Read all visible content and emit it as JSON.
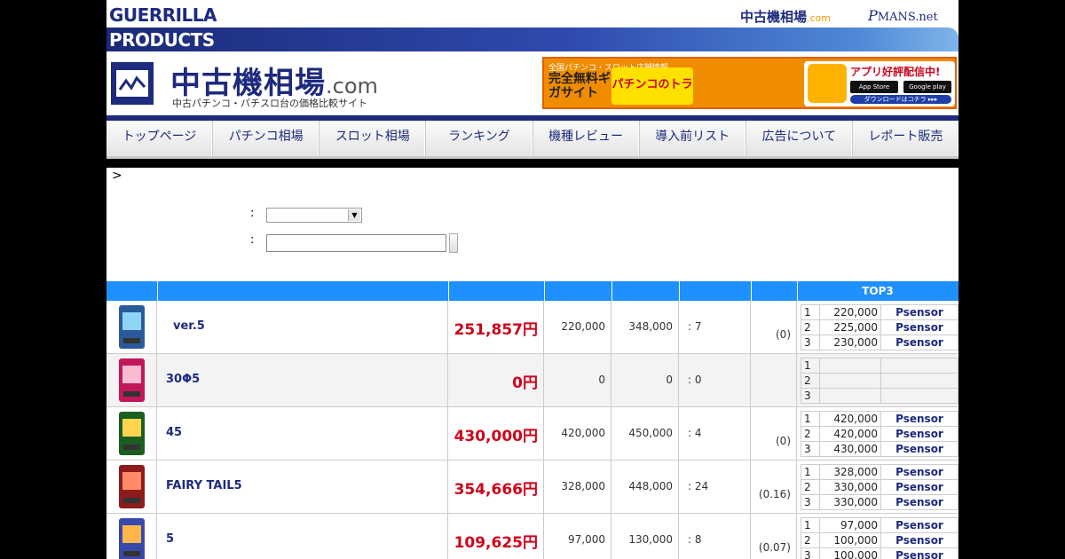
{
  "header": {
    "logo_line1": "GUERRILLA",
    "logo_line2": "PRODUCTS",
    "toplink_chuko": "中古機相場",
    "toplink_chuko_domain": ".com",
    "toplink_pmans_p": "P",
    "toplink_pmans_rest": "MANS.net",
    "site_title": "中古機相場",
    "site_title_domain": ".com",
    "site_subtitle": "中古パチンコ・パチスロ台の価格比較サイト"
  },
  "ad": {
    "line1": "全国パチンコ・スロット店舗情報",
    "line2": "完全無料ギガサイト",
    "brand": "パチンコのトラ",
    "app": "アプリ好評配信中!",
    "store1": "App Store",
    "store2": "Google play",
    "download": "ダウンロードはコチラ ▸▸▸"
  },
  "nav": [
    "トップページ",
    "パチンコ相場",
    "スロット相場",
    "ランキング",
    "機種レビュー",
    "導入前リスト",
    "広告について",
    "レポート販売"
  ],
  "breadcrumb": ">",
  "filters": {
    "label1": ":",
    "label2": ":"
  },
  "table": {
    "top3_header": "TOP3",
    "rows": [
      {
        "name": "ver.5",
        "price": "251,857円",
        "min": "220,000",
        "max": "348,000",
        "count": ": 7",
        "rate": "(0)",
        "top": [
          [
            "1",
            "220,000",
            "Psensor"
          ],
          [
            "2",
            "225,000",
            "Psensor"
          ],
          [
            "3",
            "230,000",
            "Psensor"
          ]
        ]
      },
      {
        "name": "30Φ5",
        "price": "0円",
        "min": "0",
        "max": "0",
        "count": ": 0",
        "rate": "",
        "top": [
          [
            "1",
            "",
            ""
          ],
          [
            "2",
            "",
            ""
          ],
          [
            "3",
            "",
            ""
          ]
        ]
      },
      {
        "name": "45",
        "price": "430,000円",
        "min": "420,000",
        "max": "450,000",
        "count": ": 4",
        "rate": "(0)",
        "top": [
          [
            "1",
            "420,000",
            "Psensor"
          ],
          [
            "2",
            "420,000",
            "Psensor"
          ],
          [
            "3",
            "430,000",
            "Psensor"
          ]
        ]
      },
      {
        "name": "FAIRY TAIL5",
        "price": "354,666円",
        "min": "328,000",
        "max": "448,000",
        "count": ": 24",
        "rate": "(0.16)",
        "top": [
          [
            "1",
            "328,000",
            "Psensor"
          ],
          [
            "2",
            "330,000",
            "Psensor"
          ],
          [
            "3",
            "330,000",
            "Psensor"
          ]
        ]
      },
      {
        "name": "5",
        "price": "109,625円",
        "min": "97,000",
        "max": "130,000",
        "count": ": 8",
        "rate": "(0.07)",
        "top": [
          [
            "1",
            "97,000",
            "Psensor"
          ],
          [
            "2",
            "100,000",
            "Psensor"
          ],
          [
            "3",
            "100,000",
            "Psensor"
          ]
        ]
      }
    ]
  },
  "colors": {
    "brand_navy": "#1d2a7e",
    "header_blue": "#1e90ff",
    "price_red": "#d0021b"
  },
  "icons": {
    "site_logo": "chart-monitor-icon",
    "machine_thumb": "pachinko-machine-icon"
  }
}
